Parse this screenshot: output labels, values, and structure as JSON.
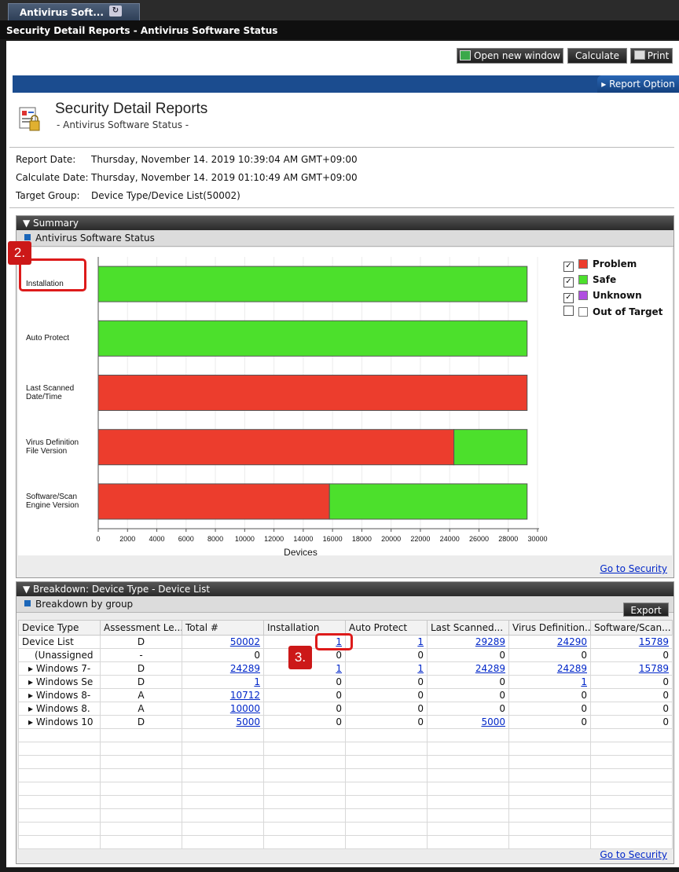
{
  "tab": {
    "label": "Antivirus Soft...",
    "refresh_icon": "refresh-icon"
  },
  "window_title": "Security Detail Reports - Antivirus Software Status",
  "toolbar": {
    "open_new_window": "Open new window",
    "calculate": "Calculate",
    "print": "Print"
  },
  "report_option": "▸ Report Option",
  "report": {
    "title": "Security Detail Reports",
    "subtitle": "- Antivirus Software Status -",
    "report_date_label": "Report Date:",
    "report_date": "Thursday, November 14. 2019 10:39:04 AM GMT+09:00",
    "calculate_date_label": "Calculate Date:",
    "calculate_date": "Thursday, November 14. 2019 01:10:49 AM GMT+09:00",
    "target_group_label": "Target Group:",
    "target_group": "Device Type/Device List(50002)"
  },
  "summary": {
    "header": "▼ Summary",
    "subheader": "Antivirus Software Status",
    "go_to_security": "Go to Security"
  },
  "chart_data": {
    "type": "bar",
    "orientation": "horizontal-stacked",
    "categories": [
      [
        "Installation"
      ],
      [
        "Auto Protect"
      ],
      [
        "Last Scanned",
        "Date/Time"
      ],
      [
        "Virus Definition",
        "File Version"
      ],
      [
        "Software/Scan",
        "Engine Version"
      ]
    ],
    "series": [
      {
        "name": "Problem",
        "color": "#ec3d2d",
        "values": [
          0,
          0,
          29289,
          24290,
          15789
        ]
      },
      {
        "name": "Safe",
        "color": "#4ce02c",
        "values": [
          29289,
          29289,
          0,
          5000,
          13500
        ]
      },
      {
        "name": "Unknown",
        "color": "#b04ee0",
        "values": [
          0,
          0,
          0,
          0,
          0
        ]
      },
      {
        "name": "Out of Target",
        "color": "#ffffff",
        "values": [
          0,
          0,
          0,
          0,
          0
        ]
      }
    ],
    "legend_checked": [
      true,
      true,
      true,
      false
    ],
    "xlabel": "Devices",
    "xlim": [
      0,
      30000
    ],
    "xticks": [
      "0",
      "2000",
      "4000",
      "6000",
      "8000",
      "10000",
      "12000",
      "14000",
      "16000",
      "18000",
      "20000",
      "22000",
      "24000",
      "26000",
      "28000",
      "30000"
    ],
    "grid": true,
    "legend_position": "top-right"
  },
  "annotations": {
    "step2": "2.",
    "step3": "3."
  },
  "breakdown": {
    "header": "▼ Breakdown: Device Type - Device List",
    "subheader": "Breakdown by group",
    "export": "Export",
    "go_to_security": "Go to Security",
    "columns": [
      "Device Type",
      "Assessment Le...",
      "Total #",
      "Installation",
      "Auto Protect",
      "Last Scanned...",
      "Virus Definition...",
      "Software/Scan..."
    ],
    "rows": [
      {
        "name": "Device List",
        "arrow": "",
        "level": "D",
        "values": [
          "50002",
          "1",
          "1",
          "29289",
          "24290",
          "15789"
        ],
        "links": [
          true,
          true,
          true,
          true,
          true,
          true
        ]
      },
      {
        "name": "(Unassigned",
        "arrow": "",
        "level": "-",
        "values": [
          "0",
          "0",
          "0",
          "0",
          "0",
          "0"
        ],
        "links": [
          false,
          false,
          false,
          false,
          false,
          false
        ]
      },
      {
        "name": "Windows 7-",
        "arrow": "▸ ",
        "level": "D",
        "values": [
          "24289",
          "1",
          "1",
          "24289",
          "24289",
          "15789"
        ],
        "links": [
          true,
          true,
          true,
          true,
          true,
          true
        ]
      },
      {
        "name": "Windows Se",
        "arrow": "▸ ",
        "level": "D",
        "values": [
          "1",
          "0",
          "0",
          "0",
          "1",
          "0"
        ],
        "links": [
          true,
          false,
          false,
          false,
          true,
          false
        ]
      },
      {
        "name": "Windows 8-",
        "arrow": "▸ ",
        "level": "A",
        "values": [
          "10712",
          "0",
          "0",
          "0",
          "0",
          "0"
        ],
        "links": [
          true,
          false,
          false,
          false,
          false,
          false
        ]
      },
      {
        "name": "Windows 8.",
        "arrow": "▸ ",
        "level": "A",
        "values": [
          "10000",
          "0",
          "0",
          "0",
          "0",
          "0"
        ],
        "links": [
          true,
          false,
          false,
          false,
          false,
          false
        ]
      },
      {
        "name": "Windows 10",
        "arrow": "▸ ",
        "level": "D",
        "values": [
          "5000",
          "0",
          "0",
          "5000",
          "0",
          "0"
        ],
        "links": [
          true,
          false,
          false,
          true,
          false,
          false
        ]
      }
    ]
  }
}
